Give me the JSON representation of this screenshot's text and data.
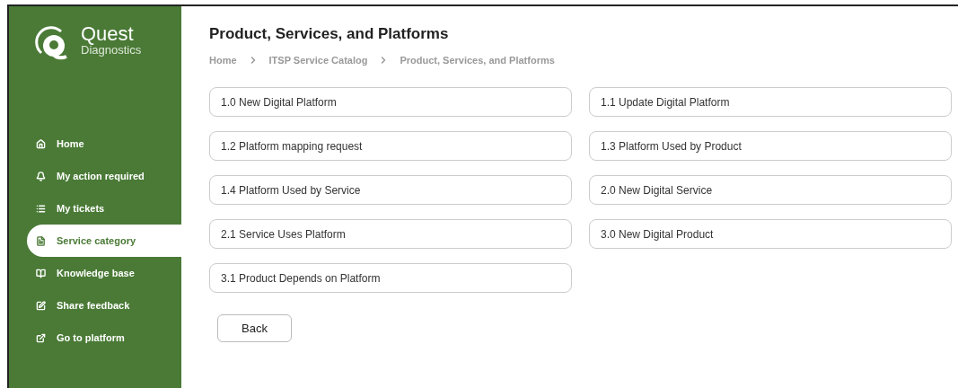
{
  "logo": {
    "name": "Quest",
    "subtitle": "Diagnostics"
  },
  "sidebar": {
    "items": [
      {
        "label": "Home",
        "selected": false
      },
      {
        "label": "My action required",
        "selected": false
      },
      {
        "label": "My tickets",
        "selected": false
      },
      {
        "label": "Service category",
        "selected": true
      },
      {
        "label": "Knowledge base",
        "selected": false
      },
      {
        "label": "Share feedback",
        "selected": false
      },
      {
        "label": "Go to platform",
        "selected": false
      }
    ]
  },
  "page": {
    "title": "Product, Services, and Platforms",
    "breadcrumbs": [
      "Home",
      "ITSP Service Catalog",
      "Product, Services, and Platforms"
    ],
    "options": [
      "1.0 New Digital Platform",
      "1.1 Update Digital Platform",
      "1.2 Platform mapping request",
      "1.3 Platform Used by Product",
      "1.4 Platform Used by Service",
      "2.0 New Digital Service",
      "2.1 Service Uses Platform",
      "3.0 New Digital Product",
      "3.1 Product Depends on Platform"
    ],
    "back_button": "Back"
  }
}
